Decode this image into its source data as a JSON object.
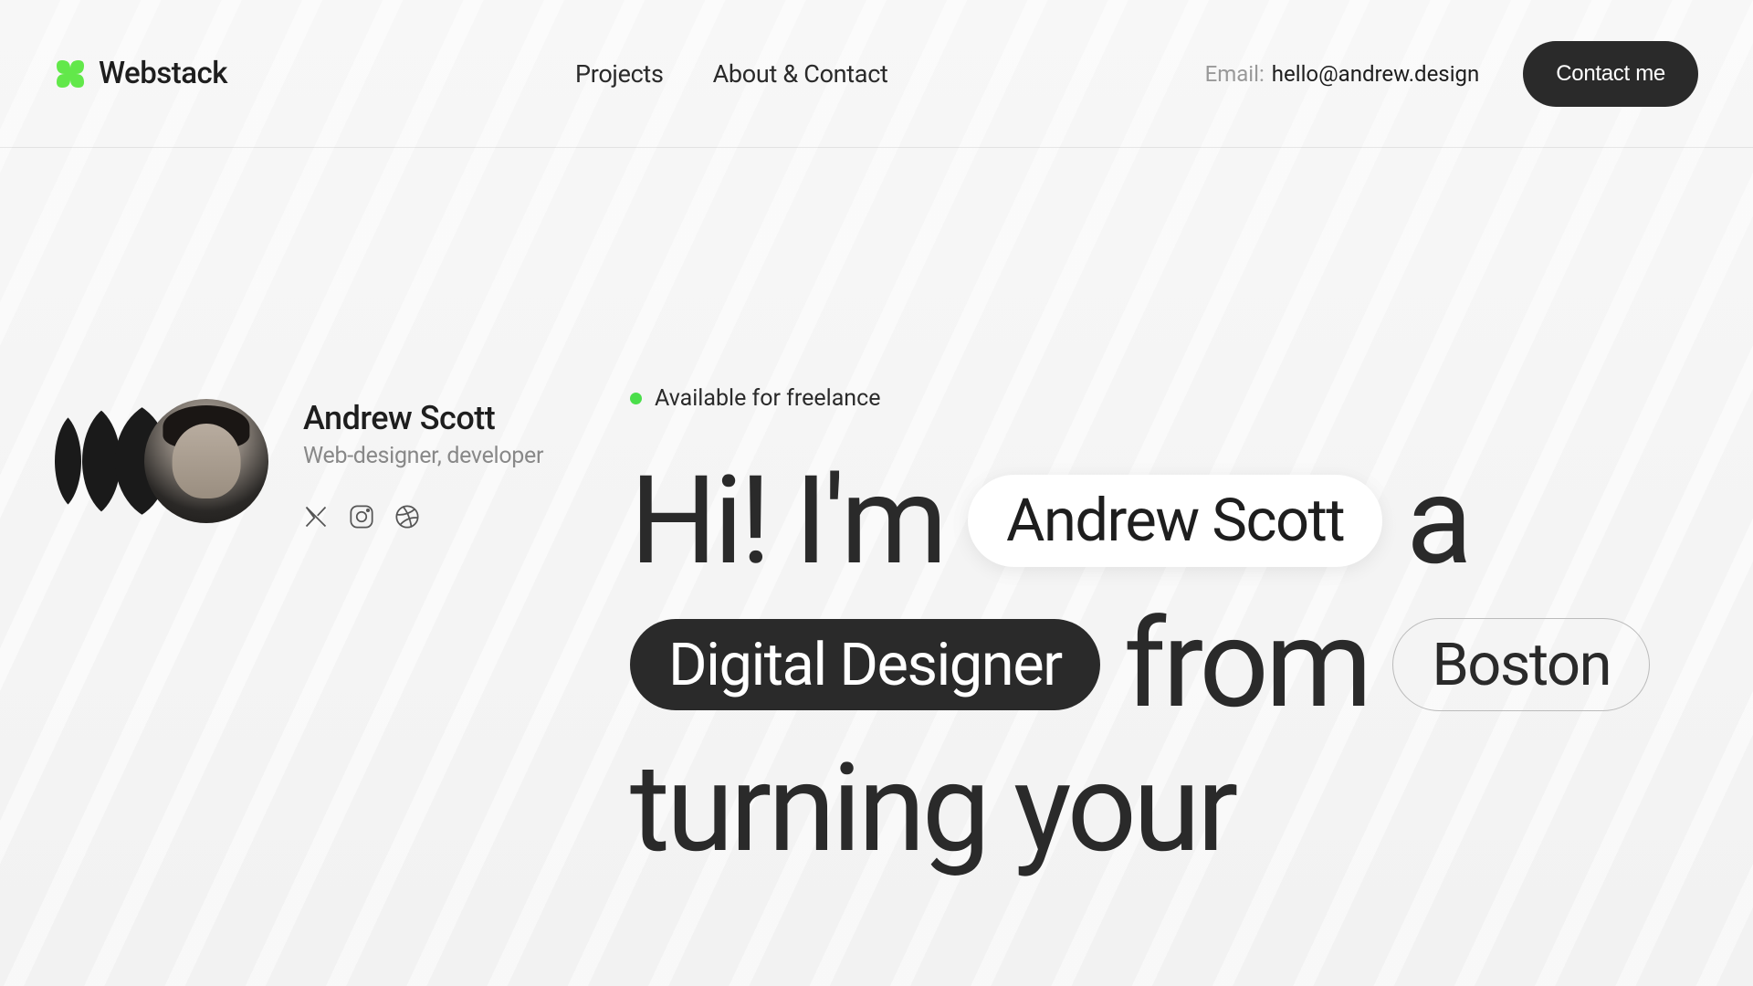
{
  "brand": "Webstack",
  "nav": {
    "projects": "Projects",
    "about": "About & Contact"
  },
  "header": {
    "email_label": "Email:",
    "email_value": "hello@andrew.design",
    "contact_btn": "Contact me"
  },
  "profile": {
    "name": "Andrew Scott",
    "role": "Web-designer, developer"
  },
  "availability": {
    "text": "Available for freelance"
  },
  "hero": {
    "word1": "Hi! I'm",
    "pill_name": "Andrew Scott",
    "word2": "a",
    "pill_role": "Digital Designer",
    "word3": "from",
    "pill_location": "Boston",
    "word4": "turning your"
  },
  "colors": {
    "accent": "#62e84a",
    "dark": "#2a2a2a"
  }
}
